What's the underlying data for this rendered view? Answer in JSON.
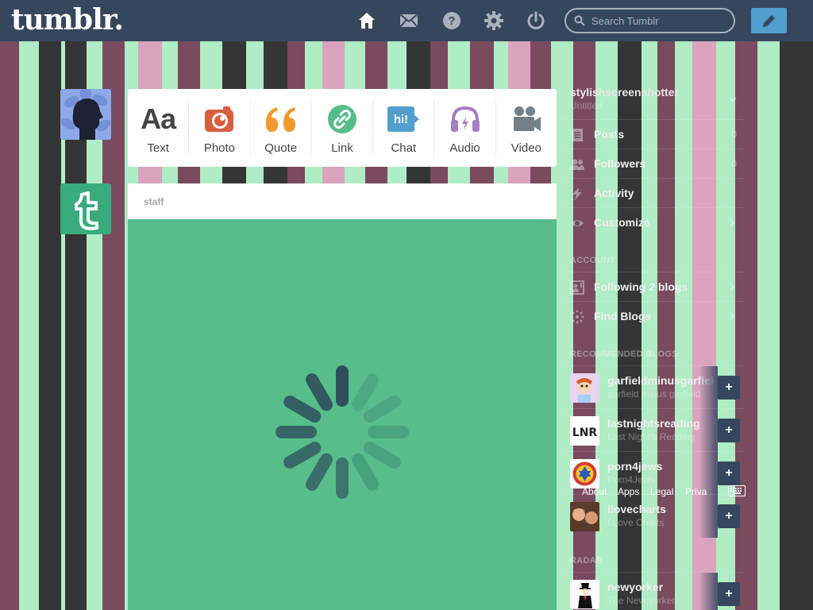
{
  "header": {
    "logo": "tumblr.",
    "search_placeholder": "Search Tumblr",
    "nav_icons": [
      "home-icon",
      "mail-icon",
      "help-icon",
      "settings-icon",
      "power-icon"
    ],
    "compose_icon": "pencil-icon"
  },
  "colors": {
    "header_bg": "#36465d",
    "compose_bg": "#529ecc",
    "post_body": "#56bd8b",
    "stripe_maroon": "#7a4a5e",
    "stripe_dark": "#353535",
    "stripe_mint": "#b0ecc5",
    "stripe_pink": "#dba4be"
  },
  "post_types": [
    {
      "label": "Text",
      "icon": "text-icon",
      "color": "#444444"
    },
    {
      "label": "Photo",
      "icon": "camera-icon",
      "color": "#d95e40"
    },
    {
      "label": "Quote",
      "icon": "quote-icon",
      "color": "#f2992e"
    },
    {
      "label": "Link",
      "icon": "link-icon",
      "color": "#56bc8a"
    },
    {
      "label": "Chat",
      "icon": "chat-icon",
      "color": "#529ecc"
    },
    {
      "label": "Audio",
      "icon": "headphones-icon",
      "color": "#a77dc2"
    },
    {
      "label": "Video",
      "icon": "video-camera-icon",
      "color": "#748089"
    }
  ],
  "post": {
    "author": "staff",
    "glyph_aa": "Aa",
    "glyph_chat": "hi!"
  },
  "sidebar": {
    "blog_name": "stylishscreenshotter",
    "blog_title": "Untitled",
    "menu": [
      {
        "label": "Posts",
        "icon": "posts-icon",
        "count": "0"
      },
      {
        "label": "Followers",
        "icon": "followers-icon",
        "count": "0"
      },
      {
        "label": "Activity",
        "icon": "lightning-icon",
        "count": ""
      },
      {
        "label": "Customize",
        "icon": "eye-icon",
        "count": ""
      }
    ],
    "account_heading": "ACCOUNT",
    "account": [
      {
        "label": "Following 2 blogs",
        "icon": "following-icon"
      },
      {
        "label": "Find Blogs",
        "icon": "find-blogs-icon"
      }
    ],
    "recommended_heading": "RECOMMENDED BLOGS",
    "recommended": [
      {
        "name": "garfieldminusgarfield",
        "title": "garfield minus garfield"
      },
      {
        "name": "lastnightsreading",
        "title": "Last Night's Reading"
      },
      {
        "name": "porn4jews",
        "title": "Porn4Jews"
      },
      {
        "name": "ilovecharts",
        "title": "I Love Charts"
      }
    ],
    "lnr_text": "LNR",
    "radar_heading": "RADAR",
    "radar": [
      {
        "name": "newyorker",
        "title": "The New Yorker"
      }
    ],
    "footer": [
      "About",
      "Apps",
      "Legal",
      "Privacy"
    ]
  }
}
